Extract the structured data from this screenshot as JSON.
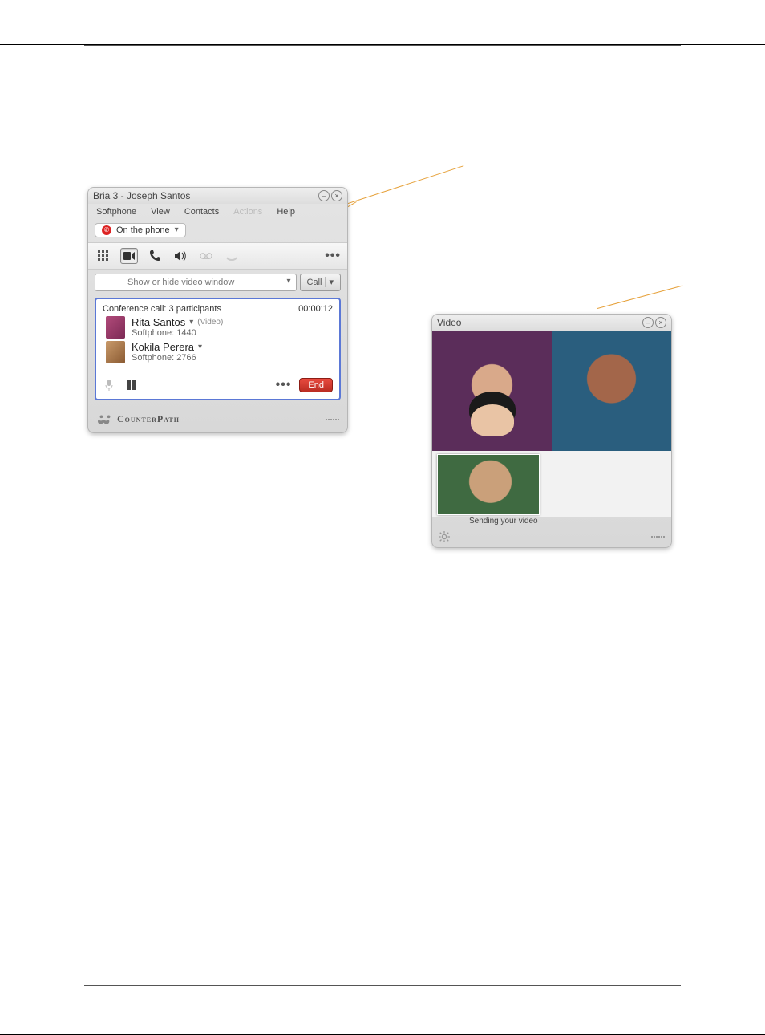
{
  "bria": {
    "title": "Bria 3 - Joseph Santos",
    "menu": {
      "softphone": "Softphone",
      "view": "View",
      "contacts": "Contacts",
      "actions": "Actions",
      "help": "Help"
    },
    "status_label": "On the phone",
    "search_placeholder": "Show or hide video window",
    "call_button": "Call",
    "conf_header": "Conference call: 3 participants",
    "conf_timer": "00:00:12",
    "participants": [
      {
        "name": "Rita Santos",
        "sub": "Softphone: 1440",
        "video": "(Video)"
      },
      {
        "name": "Kokila Perera",
        "sub": "Softphone: 2766",
        "video": ""
      }
    ],
    "end_label": "End",
    "brand": "CounterPath"
  },
  "videoWin": {
    "title": "Video",
    "sending": "Sending your video"
  }
}
